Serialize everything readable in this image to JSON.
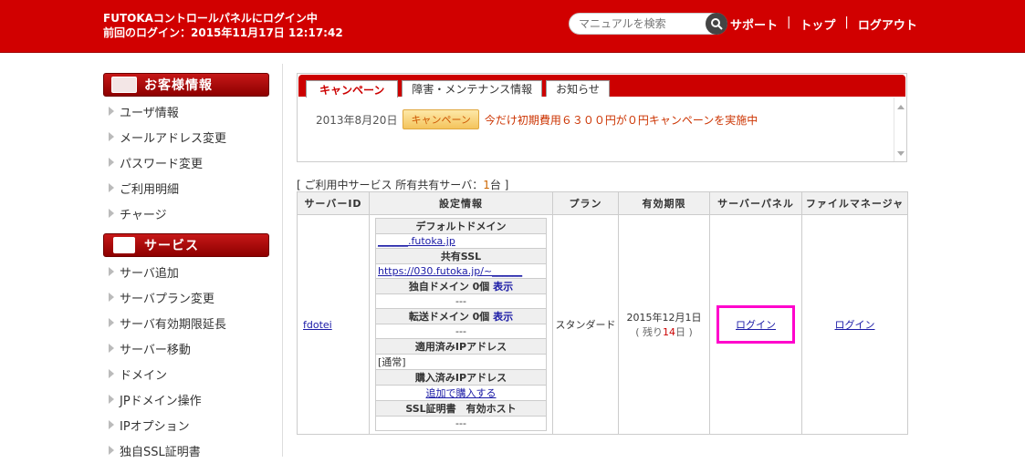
{
  "header": {
    "status_line1": "FUTOKAコントロールパネルにログイン中",
    "status_line2": "前回のログイン：2015年11月17日 12:17:42",
    "search_placeholder": "マニュアルを検索",
    "nav": [
      "サポート",
      "トップ",
      "ログアウト"
    ],
    "separator": "|"
  },
  "sidebar": {
    "customer_head": "お客様情報",
    "customer_items": [
      "ユーザ情報",
      "メールアドレス変更",
      "パスワード変更",
      "ご利用明細",
      "チャージ"
    ],
    "service_head": "サービス",
    "service_items": [
      "サーバ追加",
      "サーバプラン変更",
      "サーバ有効期限延長",
      "サーバー移動",
      "ドメイン",
      "JPドメイン操作",
      "IPオプション",
      "独自SSL証明書"
    ]
  },
  "notice": {
    "tabs": [
      "キャンペーン",
      "障害・メンテナンス情報",
      "お知らせ"
    ],
    "date": "2013年8月20日",
    "badge": "キャンペーン",
    "text": "今だけ初期費用６３００円が０円キャンペーンを実施中"
  },
  "services": {
    "caption_prefix": "[ ご利用中サービス 所有共有サーバ：",
    "count": "1",
    "caption_suffix": "台 ]",
    "headers": [
      "サーバーID",
      "設定情報",
      "プラン",
      "有効期限",
      "サーバーパネル",
      "ファイルマネージャ"
    ],
    "row": {
      "server_id": "fdotei",
      "settings": {
        "default_domain_head": "デフォルトドメイン",
        "default_domain": "______.futoka.jp",
        "shared_ssl_head": "共有SSL",
        "shared_ssl": "https://030.futoka.jp/~______",
        "own_domain_head": "独自ドメイン 0個",
        "own_domain_link": "表示",
        "own_domain_value": "---",
        "forward_domain_head": "転送ドメイン 0個",
        "forward_domain_link": "表示",
        "forward_domain_value": "---",
        "applied_ip_head": "適用済みIPアドレス",
        "applied_ip_value": "[通常]",
        "purchased_ip_head": "購入済みIPアドレス",
        "purchased_ip_link": "追加で購入する",
        "ssl_cert_head": "SSL証明書　有効ホスト",
        "ssl_cert_value": "---"
      },
      "plan": "スタンダード",
      "expiry_date": "2015年12月1日",
      "expiry_remaining_prefix": "( 残り",
      "expiry_remaining_days": "14",
      "expiry_remaining_suffix": "日 )",
      "server_panel_link": "ログイン",
      "file_manager_link": "ログイン"
    }
  },
  "colors": {
    "brand_red": "#d10000",
    "highlight": "#ff00cc"
  }
}
